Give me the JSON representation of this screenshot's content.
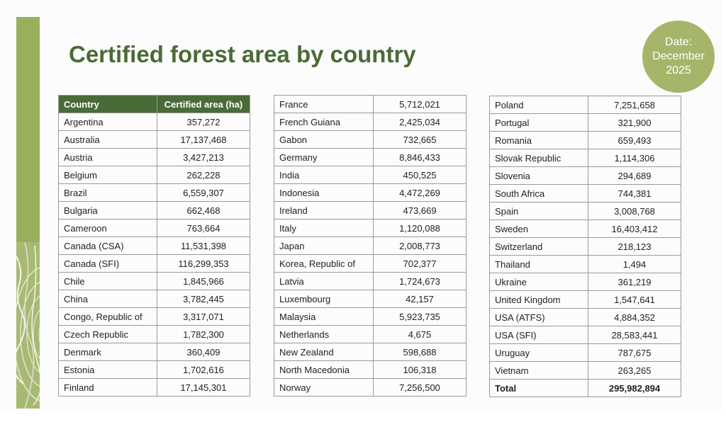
{
  "title": "Certified forest area by country",
  "date_badge": {
    "line1": "Date:",
    "line2": "December",
    "line3": "2025"
  },
  "table": {
    "headers": [
      "Country",
      "Certified area (ha)"
    ],
    "col1": [
      [
        "Argentina",
        "357,272"
      ],
      [
        "Australia",
        "17,137,468"
      ],
      [
        "Austria",
        "3,427,213"
      ],
      [
        "Belgium",
        "262,228"
      ],
      [
        "Brazil",
        "6,559,307"
      ],
      [
        "Bulgaria",
        "662,468"
      ],
      [
        "Cameroon",
        "763,664"
      ],
      [
        "Canada (CSA)",
        "11,531,398"
      ],
      [
        "Canada (SFI)",
        "116,299,353"
      ],
      [
        "Chile",
        "1,845,966"
      ],
      [
        "China",
        "3,782,445"
      ],
      [
        "Congo, Republic of",
        "3,317,071"
      ],
      [
        "Czech Republic",
        "1,782,300"
      ],
      [
        "Denmark",
        "360,409"
      ],
      [
        "Estonia",
        "1,702,616"
      ],
      [
        "Finland",
        "17,145,301"
      ]
    ],
    "col2": [
      [
        "France",
        "5,712,021"
      ],
      [
        "French Guiana",
        "2,425,034"
      ],
      [
        "Gabon",
        "732,665"
      ],
      [
        "Germany",
        "8,846,433"
      ],
      [
        "India",
        "450,525"
      ],
      [
        "Indonesia",
        "4,472,269"
      ],
      [
        "Ireland",
        "473,669"
      ],
      [
        "Italy",
        "1,120,088"
      ],
      [
        "Japan",
        "2,008,773"
      ],
      [
        "Korea, Republic of",
        "702,377"
      ],
      [
        "Latvia",
        "1,724,673"
      ],
      [
        "Luxembourg",
        "42,157"
      ],
      [
        "Malaysia",
        "5,923,735"
      ],
      [
        "Netherlands",
        "4,675"
      ],
      [
        "New Zealand",
        "598,688"
      ],
      [
        "North Macedonia",
        "106,318"
      ],
      [
        "Norway",
        "7,256,500"
      ]
    ],
    "col3": [
      [
        "Poland",
        "7,251,658"
      ],
      [
        "Portugal",
        "321,900"
      ],
      [
        "Romania",
        "659,493"
      ],
      [
        "Slovak Republic",
        "1,114,306"
      ],
      [
        "Slovenia",
        "294,689"
      ],
      [
        "South Africa",
        "744,381"
      ],
      [
        "Spain",
        "3,008,768"
      ],
      [
        "Sweden",
        "16,403,412"
      ],
      [
        "Switzerland",
        "218,123"
      ],
      [
        "Thailand",
        "1,494"
      ],
      [
        "Ukraine",
        "361,219"
      ],
      [
        "United Kingdom",
        "1,547,641"
      ],
      [
        "USA (ATFS)",
        "4,884,352"
      ],
      [
        "USA (SFI)",
        "28,583,441"
      ],
      [
        "Uruguay",
        "787,675"
      ],
      [
        "Vietnam",
        "263,265"
      ]
    ],
    "total": [
      "Total",
      "295,982,894"
    ]
  },
  "colors": {
    "heading_green": "#4a6b37",
    "accent_green": "#9aaf5c",
    "badge_green": "#a5b56a"
  }
}
